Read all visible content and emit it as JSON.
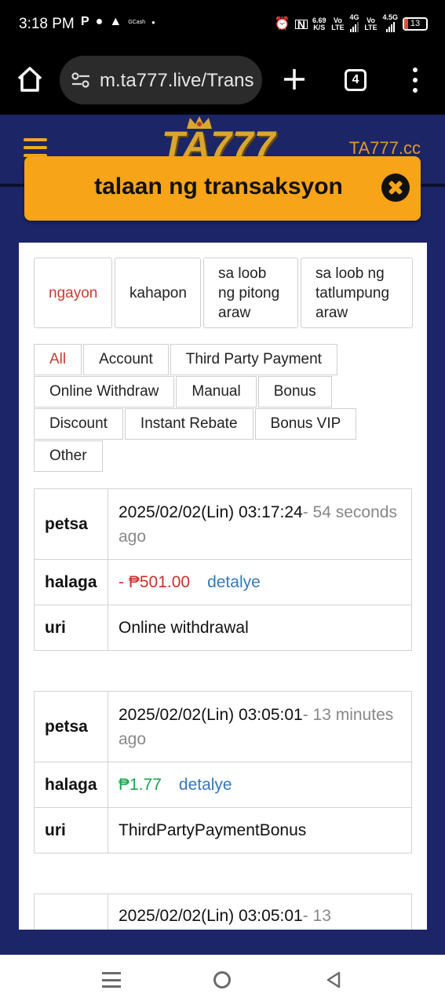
{
  "status": {
    "time": "3:18 PM",
    "app_icons": [
      "P",
      "chat-icon",
      "snapchat-icon",
      "gcash-icon",
      "dot-icon"
    ],
    "speed_value": "6.69",
    "speed_unit": "K/S",
    "net1": "Vo LTE",
    "net1_gen": "4G",
    "net2": "Vo LTE",
    "net2_gen": "4.5G",
    "battery": "13"
  },
  "browser": {
    "url": "m.ta777.live/Trans",
    "tab_count": "4"
  },
  "site": {
    "logo": "TA777",
    "url_label": "TA777.cc"
  },
  "modal": {
    "title": "talaan ng transaksyon"
  },
  "date_tabs": [
    {
      "label": "ngayon",
      "active": true
    },
    {
      "label": "kahapon",
      "active": false
    },
    {
      "label": "sa loob ng pitong araw",
      "active": false
    },
    {
      "label": "sa loob ng tatlumpung araw",
      "active": false
    }
  ],
  "filters": [
    [
      "All",
      "Account",
      "Third Party Payment"
    ],
    [
      "Online Withdraw",
      "Manual",
      "Bonus"
    ],
    [
      "Discount",
      "Instant Rebate",
      "Bonus VIP"
    ],
    [
      "Other"
    ]
  ],
  "active_filter": "All",
  "labels": {
    "date": "petsa",
    "amount": "halaga",
    "type": "uri",
    "detail": "detalye"
  },
  "transactions": [
    {
      "date": "2025/02/02(Lin) 03:17:24",
      "ago": "- 54 seconds ago",
      "amount": "- ₱501.00",
      "sign": "neg",
      "type": "Online withdrawal"
    },
    {
      "date": "2025/02/02(Lin) 03:05:01",
      "ago": "- 13 minutes ago",
      "amount": "₱1.77",
      "sign": "pos",
      "type": "ThirdPartyPaymentBonus"
    },
    {
      "date": "2025/02/02(Lin) 03:05:01",
      "ago": "- 13",
      "amount": "",
      "sign": "",
      "type": ""
    }
  ],
  "colors": {
    "accent_orange": "#f7a418",
    "site_bg": "#1c2568",
    "active_red": "#d03a2f",
    "negative": "#c9302c",
    "positive": "#1aa350",
    "link": "#3579b8"
  }
}
